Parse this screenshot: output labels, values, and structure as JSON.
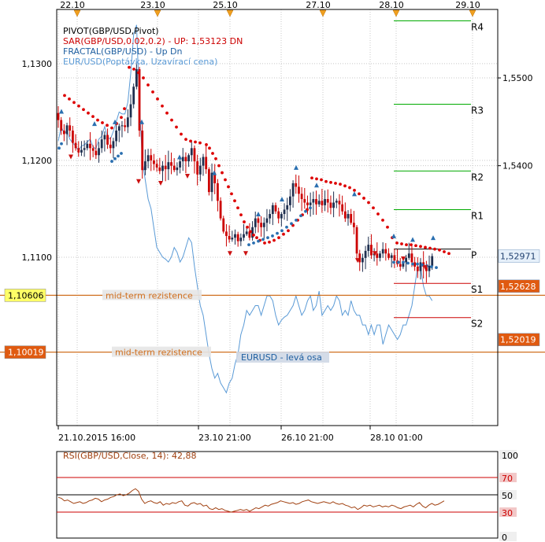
{
  "colors": {
    "grid": "#c8c8c8",
    "axis": "#000000",
    "candle_up": "#1f2f4f",
    "candle_down": "#cc0000",
    "sar": "#dd0000",
    "fractal_up": "#2a6fb0",
    "fractal_down": "#cc1111",
    "eur_line": "#5a9ad6",
    "pivot_green": "#00aa00",
    "pivot_p": "#000000",
    "pivot_red": "#cc0000",
    "resistance_line": "#d07020",
    "rsi_line": "#a04010",
    "rsi_bound": "#cc0000",
    "tag_orange": "#e05a10",
    "tag_yellow": "#ffff66",
    "tag_blue": "#e6f0fa"
  },
  "chart_data": [
    {
      "type": "candlestick",
      "legend": [
        "PIVOT(GBP/USD,Pivot)",
        "SAR(GBP/USD,0.02,0.2) -  UP: 1,53123  DN",
        "FRACTAL(GBP/USD) -  Up  Dn",
        "EUR/USD(Poptávka, Uzavírací cena)"
      ],
      "top_date_ticks": [
        "22.10",
        "23.10",
        "25.10",
        "27.10",
        "28.10",
        "29.10"
      ],
      "bottom_time_ticks": [
        "21.10.2015 16:00",
        "23.10 21:00",
        "26.10 21:00",
        "28.10 01:00"
      ],
      "left_axis": {
        "ticks": [
          1.13,
          1.12,
          1.11
        ],
        "tick_labels": [
          "1,1300",
          "1,1200",
          "1,1100"
        ],
        "range": [
          1.0926,
          1.1356
        ],
        "series": "EUR/USD"
      },
      "right_axis": {
        "ticks": [
          1.55,
          1.54
        ],
        "tick_labels": [
          "1,5500",
          "1,5400"
        ],
        "range": [
          1.5104,
          1.5578
        ],
        "series": "GBP/USD"
      },
      "left_tags": [
        {
          "value": 1.10606,
          "label": "1,10606",
          "style": "yellow"
        },
        {
          "value": 1.10019,
          "label": "1,10019",
          "style": "orange"
        }
      ],
      "right_tags": [
        {
          "value": 1.52971,
          "label": "1,52971",
          "style": "blue"
        },
        {
          "value": 1.52628,
          "label": "1,52628",
          "style": "orange"
        },
        {
          "value": 1.52019,
          "label": "1,52019",
          "style": "orange"
        }
      ],
      "pivot_levels": [
        {
          "label": "R4",
          "value": 1.5565
        },
        {
          "label": "R3",
          "value": 1.547
        },
        {
          "label": "R2",
          "value": 1.5394
        },
        {
          "label": "R1",
          "value": 1.535
        },
        {
          "label": "P",
          "value": 1.5305
        },
        {
          "label": "S1",
          "value": 1.5266
        },
        {
          "label": "S2",
          "value": 1.5227
        }
      ],
      "resistance_lines": [
        {
          "value": 1.10606,
          "label": "mid-term rezistence"
        },
        {
          "value": 1.10019,
          "label": "mid-term rezistence"
        }
      ],
      "annotation": "EURUSD - levá osa",
      "gbp_closes": [
        1.5452,
        1.544,
        1.5436,
        1.5446,
        1.544,
        1.5426,
        1.542,
        1.5415,
        1.5418,
        1.542,
        1.5425,
        1.542,
        1.5417,
        1.5412,
        1.542,
        1.543,
        1.5435,
        1.5424,
        1.542,
        1.5428,
        1.544,
        1.5445,
        1.5446,
        1.5444,
        1.5455,
        1.547,
        1.549,
        1.551,
        1.544,
        1.5395,
        1.5405,
        1.5412,
        1.5406,
        1.5402,
        1.5398,
        1.5394,
        1.54,
        1.5396,
        1.5404,
        1.54,
        1.5395,
        1.5398,
        1.5405,
        1.541,
        1.5405,
        1.5412,
        1.542,
        1.5405,
        1.539,
        1.54,
        1.541,
        1.5396,
        1.537,
        1.5392,
        1.538,
        1.536,
        1.534,
        1.5325,
        1.532,
        1.5316,
        1.5318,
        1.5322,
        1.5314,
        1.5318,
        1.5322,
        1.5325,
        1.5318,
        1.533,
        1.534,
        1.5335,
        1.533,
        1.5335,
        1.534,
        1.5345,
        1.5355,
        1.5348,
        1.534,
        1.5345,
        1.535,
        1.5355,
        1.5365,
        1.538,
        1.5376,
        1.5368,
        1.5362,
        1.5358,
        1.5355,
        1.5358,
        1.5362,
        1.5356,
        1.536,
        1.5355,
        1.5362,
        1.5358,
        1.5352,
        1.5358,
        1.536,
        1.5356,
        1.5348,
        1.534,
        1.5345,
        1.5335,
        1.533,
        1.53,
        1.529,
        1.5295,
        1.5303,
        1.531,
        1.5298,
        1.53,
        1.5295,
        1.53,
        1.5305,
        1.53,
        1.5295,
        1.5298,
        1.5292,
        1.5288,
        1.5285,
        1.529,
        1.5295,
        1.53,
        1.529,
        1.5285,
        1.528,
        1.529,
        1.5285,
        1.528,
        1.5286,
        1.5297
      ],
      "sar_points": [
        [
          82,
          1.548
        ],
        [
          88,
          1.5476
        ],
        [
          94,
          1.5472
        ],
        [
          100,
          1.5468
        ],
        [
          106,
          1.5464
        ],
        [
          112,
          1.546
        ],
        [
          118,
          1.5456
        ],
        [
          124,
          1.5452
        ],
        [
          130,
          1.5449
        ],
        [
          136,
          1.5446
        ],
        [
          142,
          1.5443
        ],
        [
          148,
          1.5448
        ],
        [
          154,
          1.5455
        ],
        [
          158,
          1.5465
        ],
        [
          164,
          1.5512
        ],
        [
          170,
          1.551
        ],
        [
          176,
          1.5506
        ],
        [
          182,
          1.55
        ],
        [
          188,
          1.5492
        ],
        [
          194,
          1.5484
        ],
        [
          200,
          1.5476
        ],
        [
          206,
          1.5468
        ],
        [
          212,
          1.546
        ],
        [
          218,
          1.5452
        ],
        [
          224,
          1.5444
        ],
        [
          230,
          1.5436
        ],
        [
          236,
          1.543
        ],
        [
          242,
          1.5428
        ],
        [
          248,
          1.5427
        ],
        [
          254,
          1.5426
        ],
        [
          262,
          1.5424
        ],
        [
          266,
          1.542
        ],
        [
          270,
          1.5414
        ],
        [
          274,
          1.5408
        ],
        [
          278,
          1.54
        ],
        [
          282,
          1.5392
        ],
        [
          286,
          1.5384
        ],
        [
          290,
          1.5376
        ],
        [
          294,
          1.5368
        ],
        [
          298,
          1.536
        ],
        [
          302,
          1.5352
        ],
        [
          306,
          1.5344
        ],
        [
          310,
          1.5336
        ],
        [
          314,
          1.533
        ],
        [
          318,
          1.5325
        ],
        [
          322,
          1.5321
        ],
        [
          326,
          1.5318
        ],
        [
          330,
          1.5315
        ],
        [
          336,
          1.5312
        ],
        [
          342,
          1.5313
        ],
        [
          348,
          1.5315
        ],
        [
          354,
          1.5318
        ],
        [
          360,
          1.5322
        ],
        [
          366,
          1.5326
        ],
        [
          372,
          1.5332
        ],
        [
          378,
          1.5338
        ],
        [
          384,
          1.5344
        ],
        [
          390,
          1.535
        ],
        [
          396,
          1.5386
        ],
        [
          402,
          1.5385
        ],
        [
          408,
          1.5384
        ],
        [
          414,
          1.5382
        ],
        [
          420,
          1.5381
        ],
        [
          426,
          1.538
        ],
        [
          432,
          1.5379
        ],
        [
          438,
          1.5377
        ],
        [
          444,
          1.5375
        ],
        [
          450,
          1.5372
        ],
        [
          456,
          1.5368
        ],
        [
          462,
          1.5363
        ],
        [
          468,
          1.5358
        ],
        [
          474,
          1.5352
        ],
        [
          480,
          1.5345
        ],
        [
          486,
          1.5338
        ],
        [
          492,
          1.533
        ],
        [
          498,
          1.5318
        ],
        [
          504,
          1.5312
        ],
        [
          510,
          1.5311
        ],
        [
          516,
          1.531
        ],
        [
          522,
          1.531
        ],
        [
          528,
          1.5309
        ],
        [
          534,
          1.5308
        ],
        [
          540,
          1.5307
        ],
        [
          546,
          1.5306
        ],
        [
          552,
          1.5305
        ],
        [
          558,
          1.5304
        ],
        [
          564,
          1.5302
        ],
        [
          570,
          1.53
        ]
      ],
      "sar_up_points": [
        [
          75,
          1.542
        ],
        [
          78,
          1.5425
        ],
        [
          142,
          1.5405
        ],
        [
          146,
          1.5408
        ],
        [
          150,
          1.5411
        ],
        [
          154,
          1.5414
        ],
        [
          316,
          1.531
        ],
        [
          322,
          1.5312
        ],
        [
          328,
          1.5314
        ],
        [
          334,
          1.5316
        ],
        [
          340,
          1.5318
        ],
        [
          346,
          1.532
        ],
        [
          352,
          1.5323
        ],
        [
          358,
          1.5326
        ],
        [
          364,
          1.533
        ],
        [
          370,
          1.5334
        ],
        [
          376,
          1.5338
        ],
        [
          382,
          1.5343
        ],
        [
          388,
          1.5348
        ],
        [
          394,
          1.5352
        ],
        [
          500,
          1.529
        ],
        [
          506,
          1.529
        ],
        [
          512,
          1.529
        ],
        [
          518,
          1.5289
        ],
        [
          524,
          1.5288
        ],
        [
          530,
          1.5288
        ],
        [
          536,
          1.5287
        ],
        [
          542,
          1.5286
        ],
        [
          548,
          1.5285
        ],
        [
          554,
          1.5284
        ]
      ],
      "eur_values": [
        1.122,
        1.1235,
        1.1228,
        1.123,
        1.1222,
        1.1218,
        1.1215,
        1.121,
        1.1215,
        1.1216,
        1.1219,
        1.1222,
        1.1214,
        1.1212,
        1.1222,
        1.1225,
        1.1235,
        1.1224,
        1.1222,
        1.123,
        1.124,
        1.125,
        1.1248,
        1.1248,
        1.126,
        1.129,
        1.133,
        1.134,
        1.126,
        1.12,
        1.118,
        1.116,
        1.115,
        1.113,
        1.111,
        1.1105,
        1.11,
        1.1098,
        1.1095,
        1.11,
        1.111,
        1.1105,
        1.1095,
        1.11,
        1.111,
        1.112,
        1.1115,
        1.109,
        1.107,
        1.105,
        1.104,
        1.102,
        1.1,
        1.0985,
        1.0975,
        1.098,
        1.097,
        1.0965,
        1.096,
        1.097,
        1.0975,
        1.099,
        1.1,
        1.102,
        1.103,
        1.1045,
        1.104,
        1.1045,
        1.105,
        1.105,
        1.104,
        1.105,
        1.106,
        1.106,
        1.1055,
        1.104,
        1.103,
        1.1035,
        1.1038,
        1.104,
        1.1045,
        1.105,
        1.106,
        1.105,
        1.104,
        1.1045,
        1.1055,
        1.106,
        1.1045,
        1.105,
        1.1065,
        1.104,
        1.1045,
        1.105,
        1.1045,
        1.105,
        1.106,
        1.1055,
        1.104,
        1.1045,
        1.104,
        1.1055,
        1.1045,
        1.104,
        1.104,
        1.103,
        1.103,
        1.102,
        1.103,
        1.102,
        1.103,
        1.103,
        1.101,
        1.102,
        1.103,
        1.1025,
        1.102,
        1.1015,
        1.102,
        1.103,
        1.103,
        1.104,
        1.105,
        1.107,
        1.109,
        1.109,
        1.107,
        1.106,
        1.106,
        1.1055
      ]
    },
    {
      "type": "line",
      "title": "RSI(GBP/USD,Close, 14): 42,88",
      "y_range": [
        0,
        100
      ],
      "y_tick_labels": [
        "100",
        "70",
        "50",
        "30",
        "0"
      ],
      "bound_lines": [
        70,
        30
      ],
      "mid_line": 50,
      "values": [
        47,
        46,
        43,
        44,
        42,
        40,
        41,
        42,
        40,
        41,
        43,
        44,
        46,
        45,
        42,
        44,
        45,
        47,
        48,
        50,
        51,
        49,
        50,
        52,
        55,
        57,
        54,
        45,
        40,
        42,
        43,
        41,
        40,
        42,
        38,
        40,
        39,
        41,
        40,
        42,
        43,
        38,
        37,
        40,
        41,
        39,
        40,
        37,
        38,
        34,
        33,
        35,
        33,
        34,
        32,
        31,
        30,
        31,
        32,
        33,
        32,
        33,
        31,
        33,
        35,
        34,
        36,
        38,
        37,
        39,
        40,
        41,
        43,
        42,
        41,
        40,
        41,
        39,
        40,
        42,
        43,
        44,
        42,
        41,
        40,
        41,
        42,
        41,
        40,
        42,
        40,
        39,
        40,
        38,
        37,
        35,
        36,
        33,
        35,
        38,
        37,
        38,
        36,
        37,
        38,
        36,
        37,
        36,
        38,
        37,
        35,
        34,
        36,
        37,
        38,
        36,
        39,
        41,
        37,
        35,
        38,
        40,
        38,
        39,
        41,
        43
      ]
    }
  ]
}
